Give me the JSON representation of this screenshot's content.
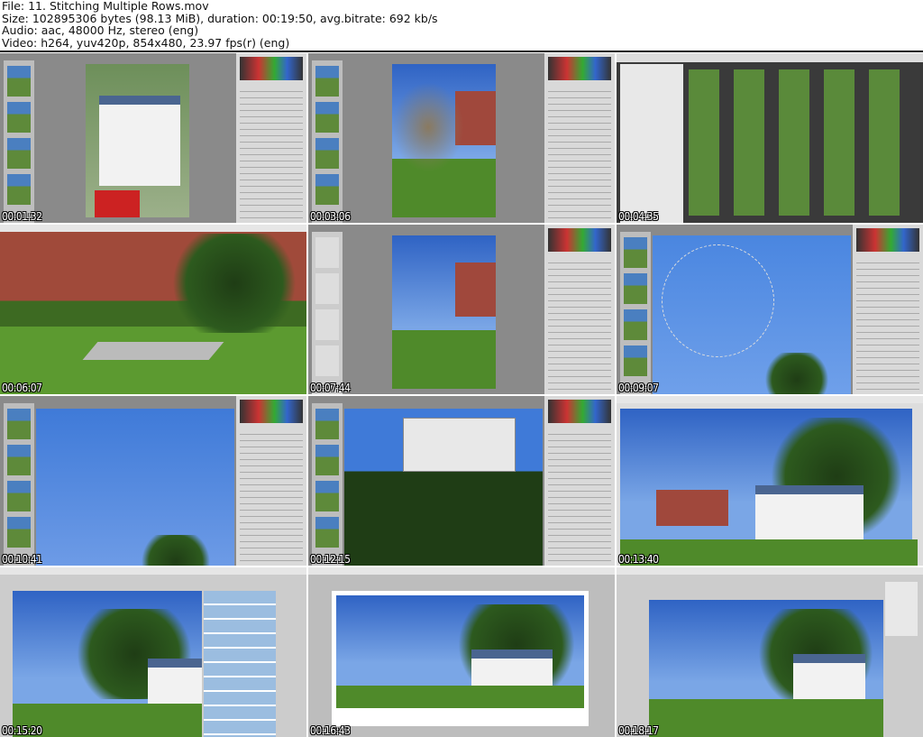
{
  "header": {
    "file": "File: 11. Stitching Multiple Rows.mov",
    "size": "Size: 102895306 bytes (98.13 MiB), duration: 00:19:50, avg.bitrate: 692 kb/s",
    "audio": "Audio: aac, 48000 Hz, stereo (eng)",
    "video": "Video: h264, yuv420p, 854x480, 23.97 fps(r) (eng)"
  },
  "thumbnails": [
    {
      "timestamp": "00:01:32"
    },
    {
      "timestamp": "00:03:06"
    },
    {
      "timestamp": "00:04:35"
    },
    {
      "timestamp": "00:06:07"
    },
    {
      "timestamp": "00:07:44"
    },
    {
      "timestamp": "00:09:07"
    },
    {
      "timestamp": "00:10:41"
    },
    {
      "timestamp": "00:12:15"
    },
    {
      "timestamp": "00:13:40"
    },
    {
      "timestamp": "00:15:20"
    },
    {
      "timestamp": "00:16:43"
    },
    {
      "timestamp": "00:18:17"
    }
  ]
}
